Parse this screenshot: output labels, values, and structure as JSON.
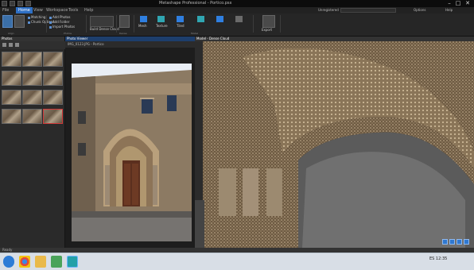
{
  "titlebar": {
    "title": "Metashape Professional - Portico.psx",
    "close": "✕",
    "minimize": "–",
    "maximize": "□"
  },
  "menubar": {
    "items": [
      "File",
      "Home",
      "View",
      "Workspace",
      "Tools",
      "Help"
    ],
    "active_index": 1,
    "status": "Unregistered",
    "right_items": [
      "Options",
      "Help"
    ]
  },
  "ribbon": {
    "groups": [
      {
        "label": "Align",
        "items": [
          "Matching",
          "Chunk Options"
        ]
      },
      {
        "label": "Photos",
        "items": [
          "Add Photos",
          "Add Folder",
          "Import Photos"
        ]
      },
      {
        "label": "Dense",
        "items": [
          "Build Dense Cloud"
        ]
      },
      {
        "label": "Model",
        "items": [
          "Mesh",
          "Texture",
          "Tiled"
        ]
      },
      {
        "label": "Export",
        "items": [
          "Export"
        ]
      }
    ]
  },
  "photos_pane": {
    "title": "Photos",
    "thumb_count": 12,
    "selected_index": 11
  },
  "viewer": {
    "title": "Photo Viewer",
    "filename": "IMG_0123.JPG - Portico"
  },
  "scene": {
    "title": "Model - Dense Cloud"
  },
  "statusbar": {
    "text": "Ready"
  },
  "taskbar": {
    "apps": [
      "start-orb",
      "chrome",
      "explorer",
      "photos",
      "metashape"
    ],
    "tray": "ES  12:35"
  },
  "colors": {
    "accent": "#2e6fc4",
    "ribbon": "#262626",
    "pane": "#2a2a2a"
  }
}
